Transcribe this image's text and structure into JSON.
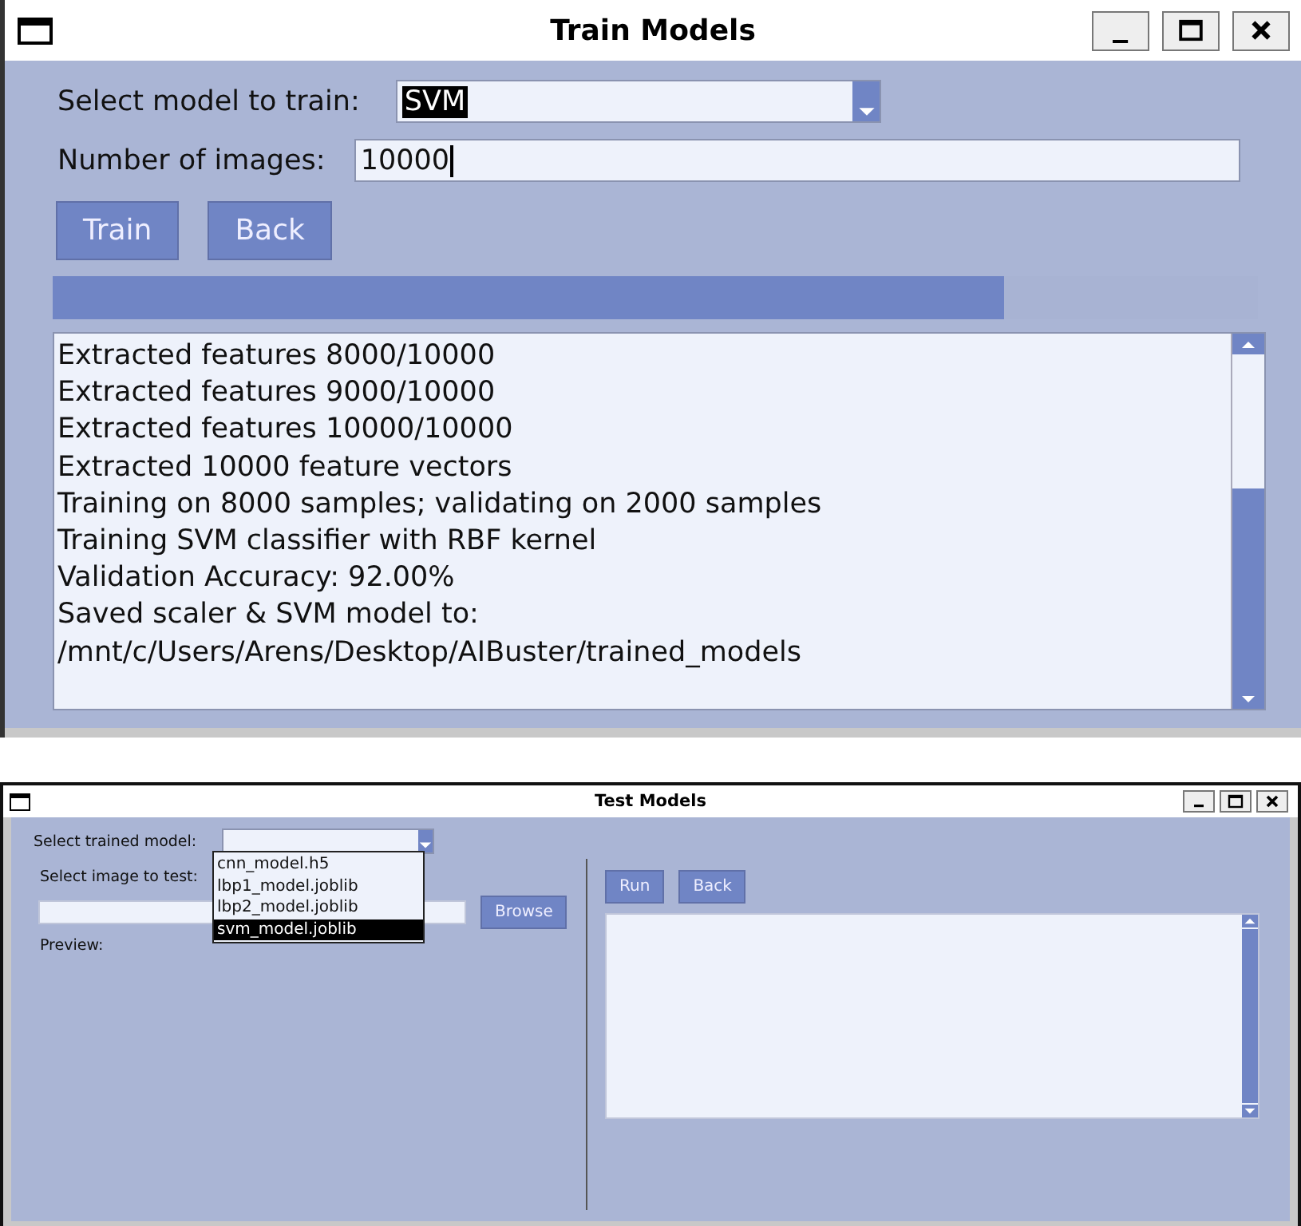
{
  "train_window": {
    "title": "Train Models",
    "model_label": "Select model to train:",
    "model_value": "SVM",
    "images_label": "Number of images:",
    "images_value": "10000",
    "buttons": [
      "Train",
      "Back"
    ],
    "progress": {
      "level": 0.79
    },
    "log": [
      "Extracted features 8000/10000",
      "Extracted features 9000/10000",
      "Extracted features 10000/10000",
      "Extracted 10000 feature vectors",
      "Training on 8000 samples; validating on 2000 samples",
      "Training SVM classifier with RBF kernel",
      "Validation Accuracy: 92.00%",
      "Saved scaler & SVM model to:",
      "/mnt/c/Users/Arens/Desktop/AIBuster/trained_models"
    ]
  },
  "test_window": {
    "title": "Test Models",
    "model_label": "Select trained model:",
    "dropdown": {
      "expanded": true,
      "options": [
        {
          "label": "cnn_model.h5",
          "selected": false
        },
        {
          "label": "lbp1_model.joblib",
          "selected": false
        },
        {
          "label": "lbp2_model.joblib",
          "selected": false
        },
        {
          "label": "svm_model.joblib",
          "selected": true
        }
      ]
    },
    "image_label": "Select image to test:",
    "browse": "Browse",
    "preview_label": "Preview:",
    "buttons": [
      "Run",
      "Back"
    ]
  }
}
